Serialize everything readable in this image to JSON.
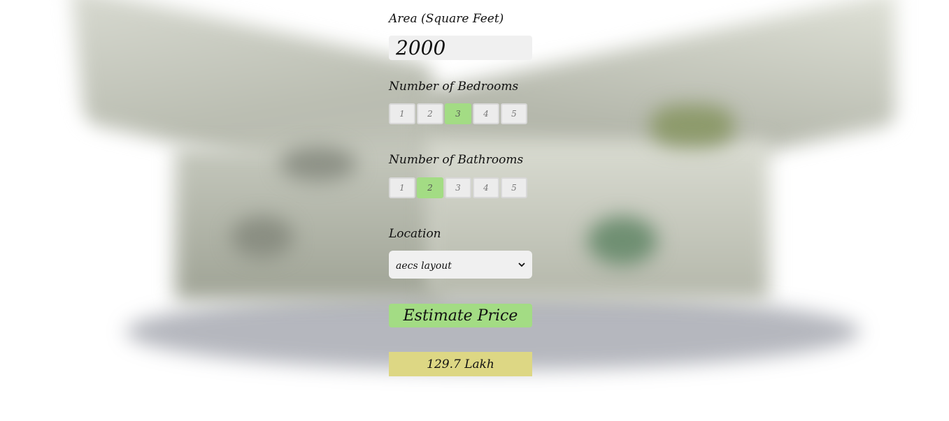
{
  "area": {
    "label": "Area (Square Feet)",
    "value": "2000"
  },
  "bedrooms": {
    "label": "Number of Bedrooms",
    "options": [
      "1",
      "2",
      "3",
      "4",
      "5"
    ],
    "selected": "3"
  },
  "bathrooms": {
    "label": "Number of Bathrooms",
    "options": [
      "1",
      "2",
      "3",
      "4",
      "5"
    ],
    "selected": "2"
  },
  "location": {
    "label": "Location",
    "selected": "aecs layout"
  },
  "estimate_button": {
    "label": "Estimate Price"
  },
  "result": {
    "text": "129.7 Lakh"
  },
  "colors": {
    "selected_option": "#a3dc84",
    "estimate_button": "#a3dc84",
    "result_background": "#ddd784",
    "input_background": "#f0f0f0"
  },
  "icons": {
    "select_arrow": "chevron-down-icon"
  }
}
